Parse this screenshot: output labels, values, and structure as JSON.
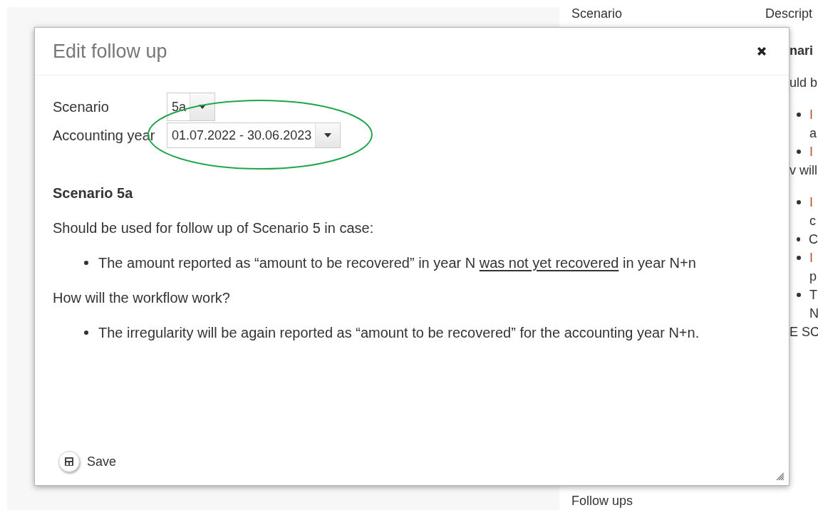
{
  "background": {
    "columns": [
      "Scenario",
      "Descript"
    ],
    "fragments": [
      {
        "kind": "heading",
        "text": "nari"
      },
      {
        "kind": "text",
        "text": "uld b"
      },
      {
        "kind": "bullet",
        "text": "I",
        "color": "#b5532a"
      },
      {
        "kind": "cont",
        "text": "a",
        "color": "#333333"
      },
      {
        "kind": "bullet",
        "text": "I",
        "color": "#b5532a"
      },
      {
        "kind": "text",
        "text": "v will"
      },
      {
        "kind": "bullet",
        "text": "I",
        "color": "#b5532a"
      },
      {
        "kind": "cont",
        "text": "c",
        "color": "#333333"
      },
      {
        "kind": "bullet",
        "text": "C",
        "color": "#333333"
      },
      {
        "kind": "bullet",
        "text": "I",
        "color": "#b5532a"
      },
      {
        "kind": "cont",
        "text": "p",
        "color": "#333333"
      },
      {
        "kind": "bullet",
        "text": "T",
        "color": "#333333"
      },
      {
        "kind": "cont",
        "text": "N",
        "color": "#333333"
      },
      {
        "kind": "text",
        "text": "E SC"
      }
    ],
    "footer": "Follow ups"
  },
  "dialog": {
    "title": "Edit follow up",
    "fields": [
      {
        "label": "Scenario",
        "value": "5a",
        "highlighted": false
      },
      {
        "label": "Accounting year",
        "value": "01.07.2022 - 30.06.2023",
        "highlighted": true
      }
    ],
    "content": [
      {
        "kind": "heading",
        "segments": [
          {
            "text": "Scenario 5a",
            "underline": false
          }
        ]
      },
      {
        "kind": "text",
        "segments": [
          {
            "text": "Should be used for follow up of Scenario 5 in case:",
            "underline": false
          }
        ]
      },
      {
        "kind": "bullet",
        "segments": [
          {
            "text": "The amount reported as “amount to be recovered” in year N ",
            "underline": false
          },
          {
            "text": "was not yet recovered",
            "underline": true
          },
          {
            "text": " in year N+n",
            "underline": false
          }
        ]
      },
      {
        "kind": "text",
        "segments": [
          {
            "text": "How will the workflow work?",
            "underline": false
          }
        ]
      },
      {
        "kind": "bullet",
        "segments": [
          {
            "text": "The irregularity will be again reported as “amount to be recovered” for the accounting year N+n.",
            "underline": false
          }
        ]
      }
    ],
    "save": "Save"
  }
}
